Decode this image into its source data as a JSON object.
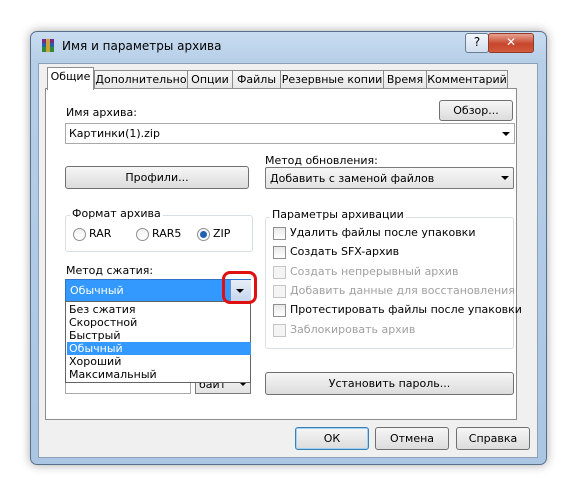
{
  "window": {
    "title": "Имя и параметры архива",
    "help_glyph": "?",
    "close_glyph": "✕"
  },
  "tabs": [
    {
      "label": "Общие",
      "active": true
    },
    {
      "label": "Дополнительно"
    },
    {
      "label": "Опции"
    },
    {
      "label": "Файлы"
    },
    {
      "label": "Резервные копии"
    },
    {
      "label": "Время"
    },
    {
      "label": "Комментарий"
    }
  ],
  "archive_name": {
    "label": "Имя архива:",
    "value": "Картинки(1).zip",
    "browse_button": "Обзор..."
  },
  "profiles_button": "Профили...",
  "update_method": {
    "label": "Метод обновления:",
    "value": "Добавить с заменой файлов"
  },
  "archive_format": {
    "title": "Формат архива",
    "options": [
      "RAR",
      "RAR5",
      "ZIP"
    ],
    "selected": "ZIP"
  },
  "compression_method": {
    "label": "Метод сжатия:",
    "value": "Обычный",
    "options": [
      "Без сжатия",
      "Скоростной",
      "Быстрый",
      "Обычный",
      "Хороший",
      "Максимальный"
    ],
    "selected_index": 3
  },
  "volume_unit": "байт",
  "archive_params": {
    "title": "Параметры архивации",
    "items": [
      {
        "label": "Удалить файлы после упаковки",
        "enabled": true
      },
      {
        "label": "Создать SFX-архив",
        "enabled": true
      },
      {
        "label": "Создать непрерывный архив",
        "enabled": false
      },
      {
        "label": "Добавить данные для восстановления",
        "enabled": false
      },
      {
        "label": "Протестировать файлы после упаковки",
        "enabled": true
      },
      {
        "label": "Заблокировать архив",
        "enabled": false
      }
    ]
  },
  "set_password_button": "Установить пароль...",
  "footer": {
    "ok": "ОК",
    "cancel": "Отмена",
    "help": "Справка"
  }
}
